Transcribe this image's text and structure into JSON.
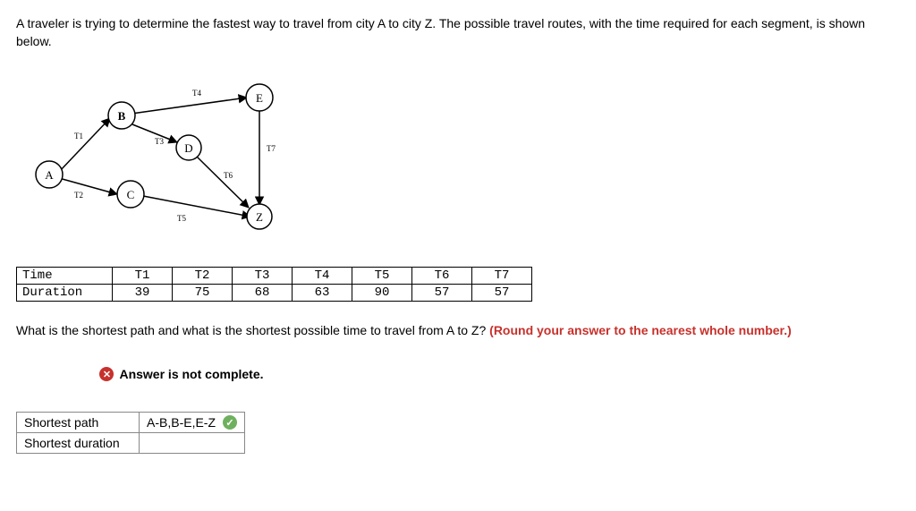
{
  "question": {
    "text": "A traveler is trying to determine the fastest way to travel from city A to city Z. The possible travel routes, with the time required for each segment, is shown below."
  },
  "graph": {
    "nodes": {
      "A": "A",
      "B": "B",
      "C": "C",
      "D": "D",
      "E": "E",
      "Z": "Z"
    },
    "edges": {
      "T1": "T1",
      "T2": "T2",
      "T3": "T3",
      "T4": "T4",
      "T5": "T5",
      "T6": "T6",
      "T7": "T7"
    }
  },
  "table": {
    "row_labels": {
      "time": "Time",
      "duration": "Duration"
    },
    "headers": [
      "T1",
      "T2",
      "T3",
      "T4",
      "T5",
      "T6",
      "T7"
    ],
    "values": [
      "39",
      "75",
      "68",
      "63",
      "90",
      "57",
      "57"
    ]
  },
  "question2": {
    "prefix": "What is the shortest path and what is the shortest possible time to travel from A to Z? ",
    "hint": "(Round your answer to the nearest whole number.)"
  },
  "feedback": {
    "text": "Answer is not complete."
  },
  "answers": {
    "row1": {
      "label": "Shortest path",
      "value": "A-B,B-E,E-Z"
    },
    "row2": {
      "label": "Shortest duration",
      "value": ""
    }
  }
}
